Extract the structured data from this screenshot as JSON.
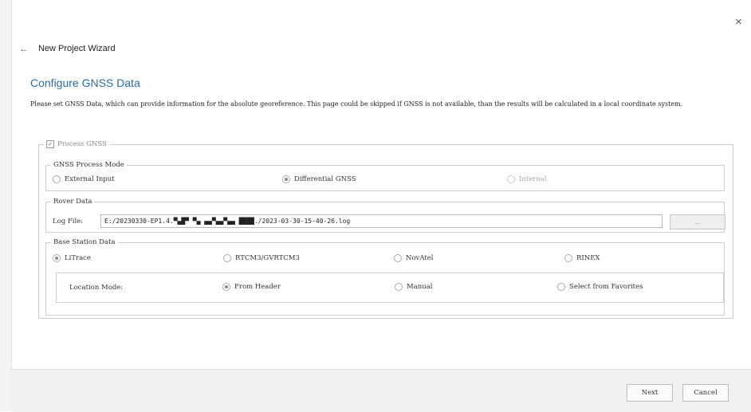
{
  "window": {
    "close_glyph": "×"
  },
  "header": {
    "back_glyph": "←",
    "title": "New Project Wizard"
  },
  "page": {
    "title": "Configure GNSS Data",
    "description": "Please set GNSS Data, which can provide information for the absolute georeference. This page could be skipped if GNSS is not available, than the results will be calculated in a local coordinate system."
  },
  "process_gnss": {
    "label": "Process GNSS",
    "checked": true,
    "check_glyph": "✓"
  },
  "mode_group": {
    "title": "GNSS Process Mode",
    "options": [
      {
        "label": "External Input",
        "selected": false,
        "enabled": true
      },
      {
        "label": "Differential GNSS",
        "selected": true,
        "enabled": true
      },
      {
        "label": "Internal",
        "selected": false,
        "enabled": false
      }
    ]
  },
  "rover_group": {
    "title": "Rover Data",
    "log_file_label": "Log File:",
    "log_file_value": "E:/20230330-EP1.4.▀▄█▀ ▀▄ ▄▄▀▄▄▀▄▄ ████./2023-03-30-15-40-26.log",
    "browse_label": "..."
  },
  "base_group": {
    "title": "Base Station Data",
    "options": [
      {
        "label": "LiTrace",
        "selected": true
      },
      {
        "label": "RTCM3/GVRTCM3",
        "selected": false
      },
      {
        "label": "NovAtel",
        "selected": false
      },
      {
        "label": "RINEX",
        "selected": false
      }
    ],
    "location_mode_label": "Location Mode:",
    "location_options": [
      {
        "label": "From Header",
        "selected": true
      },
      {
        "label": "Manual",
        "selected": false
      },
      {
        "label": "Select from Favorites",
        "selected": false
      }
    ]
  },
  "footer": {
    "next_label": "Next",
    "cancel_label": "Cancel"
  }
}
